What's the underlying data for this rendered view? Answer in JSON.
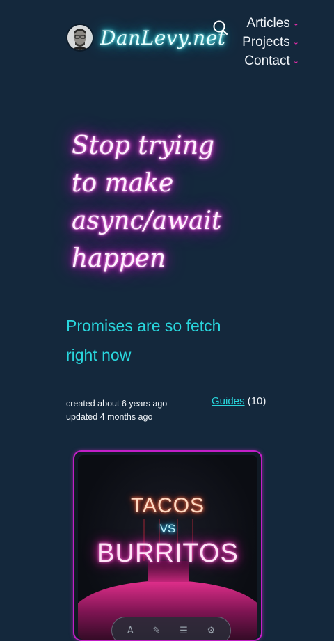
{
  "header": {
    "site_title": "DanLevy.net",
    "nav": [
      {
        "label": "Articles"
      },
      {
        "label": "Projects"
      },
      {
        "label": "Contact"
      }
    ]
  },
  "article": {
    "title": "Stop trying to make async/await happen",
    "subtitle": "Promises are so fetch right now",
    "created": "created about 6 years ago",
    "updated": "updated 4 months ago",
    "category_link": "Guides",
    "category_count": "(10)"
  },
  "featured_image": {
    "line1": "TACOS",
    "line2": "VS",
    "line3": "BURRITOS"
  },
  "colors": {
    "background": "#14283c",
    "accent_cyan": "#29d6dd",
    "accent_pink": "#ff2fb8"
  },
  "icons": [
    "avatar-photo",
    "search-icon",
    "chevron-down-icon"
  ]
}
